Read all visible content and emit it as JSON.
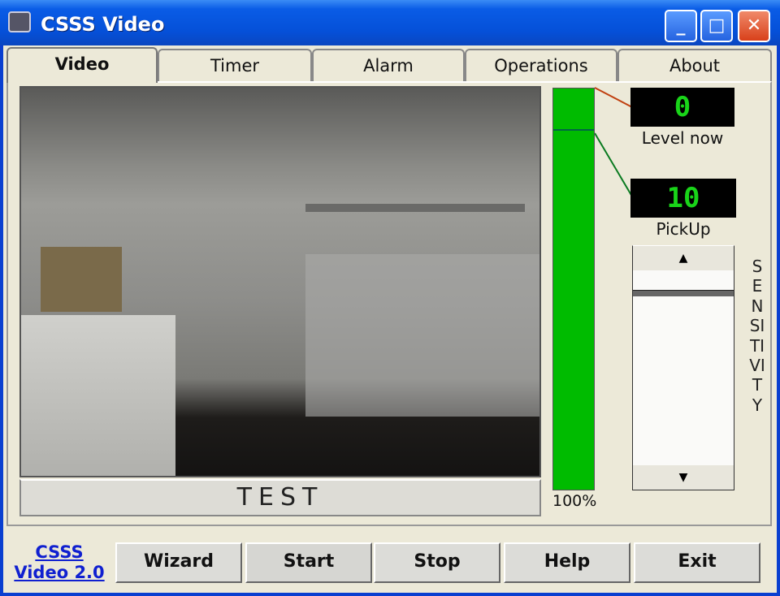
{
  "window": {
    "title": "CSSS Video",
    "controls": [
      "minimize",
      "maximize",
      "close"
    ]
  },
  "tabs": [
    {
      "label": "Video",
      "active": true
    },
    {
      "label": "Timer"
    },
    {
      "label": "Alarm"
    },
    {
      "label": "Operations"
    },
    {
      "label": "About"
    }
  ],
  "video": {
    "overlay_label": "TEST"
  },
  "meter": {
    "level_percent": 100,
    "percent_label": "100%",
    "color": "#00bb00"
  },
  "level_now": {
    "value": "0",
    "label": "Level now"
  },
  "pickup": {
    "value": "10",
    "label": "PickUp"
  },
  "sensitivity": {
    "label": "SENSITIVITY",
    "up_icon": "triangle-up",
    "down_icon": "triangle-down"
  },
  "footer": {
    "brand_line1": "CSSS",
    "brand_line2": "Video 2.0",
    "buttons": [
      "Wizard",
      "Start",
      "Stop",
      "Help",
      "Exit"
    ]
  }
}
